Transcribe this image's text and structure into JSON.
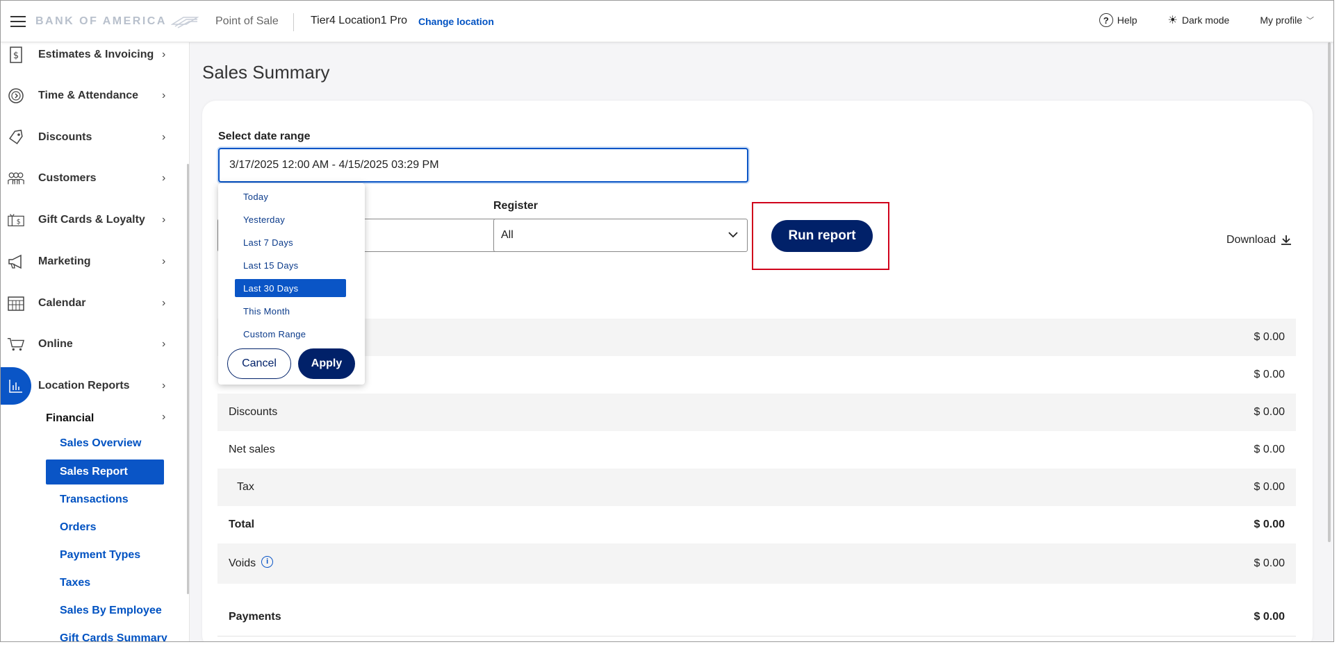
{
  "header": {
    "logo_text": "BANK OF AMERICA",
    "app_name": "Point of Sale",
    "location_name": "Tier4 Location1 Pro",
    "change_location": "Change location",
    "help": "Help",
    "dark_mode": "Dark mode",
    "my_profile": "My profile"
  },
  "sidebar": {
    "items": [
      {
        "label": "Estimates & Invoicing",
        "icon": "invoice-icon"
      },
      {
        "label": "Time & Attendance",
        "icon": "clock-icon"
      },
      {
        "label": "Discounts",
        "icon": "tag-icon"
      },
      {
        "label": "Customers",
        "icon": "people-icon"
      },
      {
        "label": "Gift Cards & Loyalty",
        "icon": "gift-card-icon"
      },
      {
        "label": "Marketing",
        "icon": "megaphone-icon"
      },
      {
        "label": "Calendar",
        "icon": "calendar-icon"
      },
      {
        "label": "Online",
        "icon": "cart-icon"
      },
      {
        "label": "Location Reports",
        "icon": "bar-chart-icon"
      }
    ],
    "financial": "Financial",
    "sub_items": [
      "Sales Overview",
      "Sales Report",
      "Transactions",
      "Orders",
      "Payment Types",
      "Taxes",
      "Sales By Employee",
      "Gift Cards Summary"
    ],
    "active_sub": "Sales Report"
  },
  "main": {
    "title": "Sales Summary",
    "date_label": "Select date range",
    "date_value": "3/17/2025 12:00 AM - 4/15/2025 03:29 PM",
    "register_label": "Register",
    "register_value": "All",
    "run_report": "Run report",
    "download": "Download",
    "rows": [
      {
        "label": "",
        "value": "$ 0.00"
      },
      {
        "label": "",
        "value": "$ 0.00"
      },
      {
        "label": "Discounts",
        "value": "$ 0.00"
      },
      {
        "label": "Net sales",
        "value": "$ 0.00"
      },
      {
        "label": "Tax",
        "value": "$ 0.00"
      },
      {
        "label": "Total",
        "value": "$ 0.00"
      },
      {
        "label": "Voids",
        "value": "$ 0.00"
      },
      {
        "label": "Payments",
        "value": "$ 0.00"
      }
    ]
  },
  "dropdown": {
    "options": [
      "Today",
      "Yesterday",
      "Last 7 Days",
      "Last 15 Days",
      "Last 30 Days",
      "This Month",
      "Custom Range"
    ],
    "selected": "Last 30 Days",
    "cancel": "Cancel",
    "apply": "Apply"
  }
}
